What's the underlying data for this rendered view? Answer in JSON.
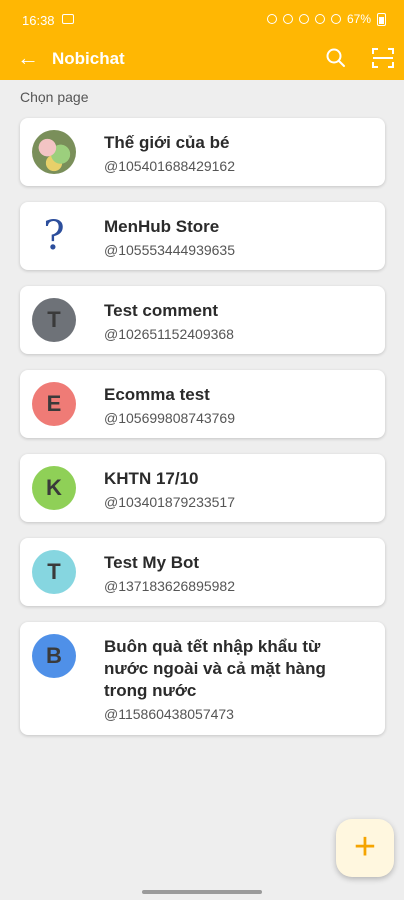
{
  "status_bar": {
    "time": "16:38",
    "battery": "67%"
  },
  "app_bar": {
    "title": "Nobichat",
    "back_icon": "back-arrow-icon",
    "search_icon": "search-icon",
    "scan_icon": "scan-icon"
  },
  "section_label": "Chọn page",
  "pages": [
    {
      "name": "Thế giới của bé",
      "id": "@105401688429162",
      "avatar_type": "photo"
    },
    {
      "name": "MenHub Store",
      "id": "@105553444939635",
      "avatar_type": "question"
    },
    {
      "name": "Test comment",
      "id": "@102651152409368",
      "avatar_letter": "T",
      "avatar_color": "#6e7278"
    },
    {
      "name": "Ecomma test",
      "id": "@105699808743769",
      "avatar_letter": "E",
      "avatar_color": "#ef7b76"
    },
    {
      "name": "KHTN 17/10",
      "id": "@103401879233517",
      "avatar_letter": "K",
      "avatar_color": "#8fd057"
    },
    {
      "name": "Test My Bot",
      "id": "@137183626895982",
      "avatar_letter": "T",
      "avatar_color": "#86d6e0"
    },
    {
      "name": "Buôn quà tết nhập khẩu từ nước ngoài và cả mặt hàng trong nước",
      "id": "@115860438057473",
      "avatar_letter": "B",
      "avatar_color": "#4f90e8"
    }
  ],
  "fab": {
    "label": "+",
    "icon": "plus-icon"
  },
  "colors": {
    "primary": "#ffb703",
    "background": "#eeeeee"
  }
}
